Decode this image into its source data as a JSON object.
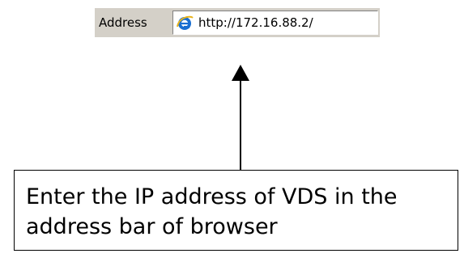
{
  "address_bar": {
    "label": "Address",
    "url": "http://172.16.88.2/",
    "icon": "internet-explorer-icon"
  },
  "callout": {
    "text": "Enter the IP address of VDS in the address bar of browser"
  },
  "colors": {
    "toolbar_background": "#d4d0c8",
    "ie_icon_blue": "#1a6fd1",
    "ie_icon_gold": "#e8b31c",
    "text": "#000000"
  }
}
